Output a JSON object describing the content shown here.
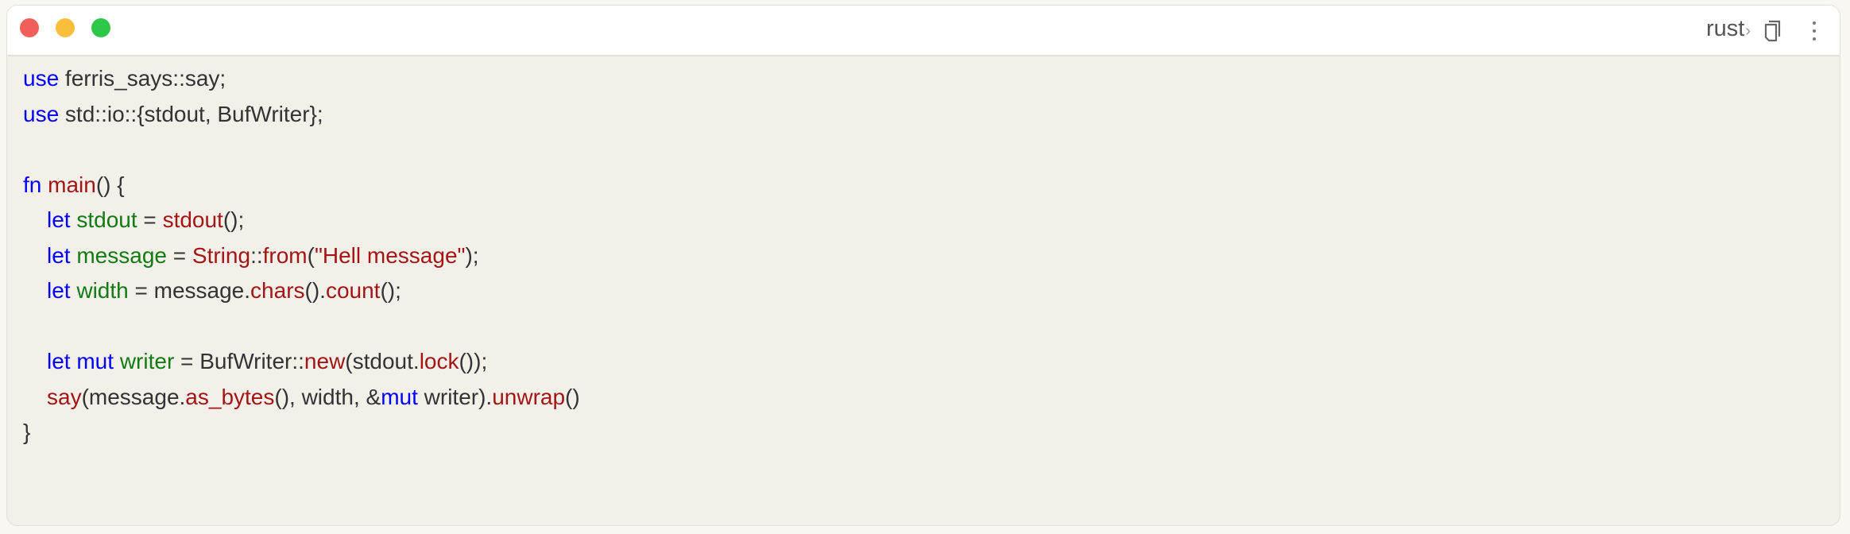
{
  "window": {
    "traffic_lights": [
      {
        "name": "close",
        "color": "#f25e58"
      },
      {
        "name": "minimize",
        "color": "#fbbd3c"
      },
      {
        "name": "maximize",
        "color": "#2dc84a"
      }
    ],
    "language_label": "rust",
    "language_chevron": "›",
    "icons": [
      "copy-icon",
      "more-vertical-icon"
    ]
  },
  "colors": {
    "keyword": "#0000ff",
    "variable": "#117a11",
    "function": "#a31515",
    "string": "#a31515",
    "plain": "#333333"
  },
  "code_lines": [
    {
      "indent": 0,
      "tokens": [
        {
          "t": "use",
          "k": "keyword"
        },
        {
          "t": " ferris_says::say;",
          "k": "plain"
        }
      ]
    },
    {
      "indent": 0,
      "tokens": [
        {
          "t": "use",
          "k": "keyword"
        },
        {
          "t": " std::io::{stdout, BufWriter};",
          "k": "plain"
        }
      ]
    },
    {
      "indent": 0,
      "tokens": []
    },
    {
      "indent": 0,
      "tokens": [
        {
          "t": "fn",
          "k": "keyword"
        },
        {
          "t": " ",
          "k": "plain"
        },
        {
          "t": "main",
          "k": "function"
        },
        {
          "t": "() {",
          "k": "plain"
        }
      ]
    },
    {
      "indent": 1,
      "tokens": [
        {
          "t": "let",
          "k": "keyword"
        },
        {
          "t": " ",
          "k": "plain"
        },
        {
          "t": "stdout",
          "k": "variable"
        },
        {
          "t": " = ",
          "k": "plain"
        },
        {
          "t": "stdout",
          "k": "function"
        },
        {
          "t": "();",
          "k": "plain"
        }
      ]
    },
    {
      "indent": 1,
      "tokens": [
        {
          "t": "let",
          "k": "keyword"
        },
        {
          "t": " ",
          "k": "plain"
        },
        {
          "t": "message",
          "k": "variable"
        },
        {
          "t": " = ",
          "k": "plain"
        },
        {
          "t": "String",
          "k": "function"
        },
        {
          "t": "::",
          "k": "plain"
        },
        {
          "t": "from",
          "k": "function"
        },
        {
          "t": "(",
          "k": "plain"
        },
        {
          "t": "\"Hell message\"",
          "k": "string"
        },
        {
          "t": ");",
          "k": "plain"
        }
      ]
    },
    {
      "indent": 1,
      "tokens": [
        {
          "t": "let",
          "k": "keyword"
        },
        {
          "t": " ",
          "k": "plain"
        },
        {
          "t": "width",
          "k": "variable"
        },
        {
          "t": " = message.",
          "k": "plain"
        },
        {
          "t": "chars",
          "k": "function"
        },
        {
          "t": "().",
          "k": "plain"
        },
        {
          "t": "count",
          "k": "function"
        },
        {
          "t": "();",
          "k": "plain"
        }
      ]
    },
    {
      "indent": 0,
      "tokens": []
    },
    {
      "indent": 1,
      "tokens": [
        {
          "t": "let",
          "k": "keyword"
        },
        {
          "t": " ",
          "k": "plain"
        },
        {
          "t": "mut",
          "k": "keyword"
        },
        {
          "t": " ",
          "k": "plain"
        },
        {
          "t": "writer",
          "k": "variable"
        },
        {
          "t": " = BufWriter::",
          "k": "plain"
        },
        {
          "t": "new",
          "k": "function"
        },
        {
          "t": "(stdout.",
          "k": "plain"
        },
        {
          "t": "lock",
          "k": "function"
        },
        {
          "t": "());",
          "k": "plain"
        }
      ]
    },
    {
      "indent": 1,
      "tokens": [
        {
          "t": "say",
          "k": "function"
        },
        {
          "t": "(message.",
          "k": "plain"
        },
        {
          "t": "as_bytes",
          "k": "function"
        },
        {
          "t": "(), width, &",
          "k": "plain"
        },
        {
          "t": "mut",
          "k": "keyword"
        },
        {
          "t": " writer).",
          "k": "plain"
        },
        {
          "t": "unwrap",
          "k": "function"
        },
        {
          "t": "()",
          "k": "plain"
        }
      ]
    },
    {
      "indent": 0,
      "tokens": [
        {
          "t": "}",
          "k": "plain"
        }
      ]
    }
  ]
}
